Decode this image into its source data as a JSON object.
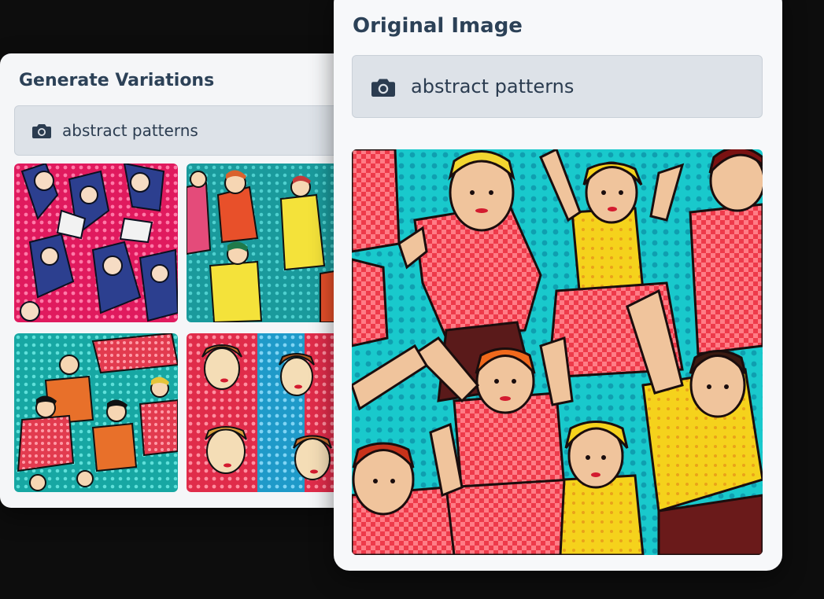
{
  "variations_panel": {
    "title": "Generate Variations",
    "prompt": "abstract patterns",
    "prompt_icon": "camera-icon",
    "thumbnails": [
      "pink-pop-art-dancers",
      "teal-pop-art-dancers",
      "teal-pop-art-couples",
      "red-pop-art-women"
    ]
  },
  "original_panel": {
    "title": "Original Image",
    "prompt": "abstract patterns",
    "prompt_icon": "camera-icon",
    "image": "pop-art-dancers-teal-background"
  },
  "colors": {
    "page_background": "#0d0d0d",
    "card_background": "#f5f6f8",
    "prompt_background": "#dde2e8",
    "title_text": "#2c4157"
  }
}
